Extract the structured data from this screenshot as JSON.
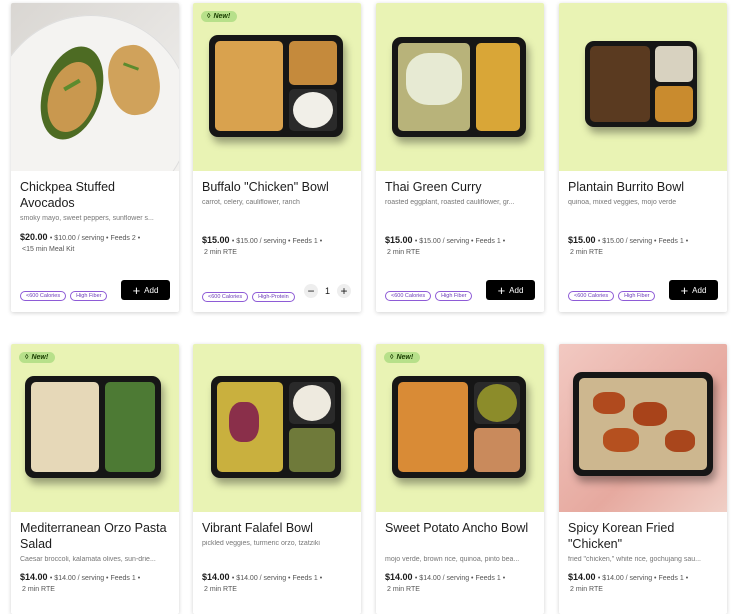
{
  "colors": {
    "card_bg": "#e9f3b4",
    "tag_border": "#8e5bd6",
    "add_button": "#000000",
    "new_badge": "#b7e08a"
  },
  "products": [
    {
      "name": "Chickpea Stuffed Avocados",
      "desc": "smoky mayo, sweet peppers, sunflower s...",
      "price": "$20.00",
      "serving": "• $10.00 / serving • Feeds 2 •",
      "time": "<15 min Meal Kit",
      "badge": "",
      "tags": [
        "<600 Calories",
        "High Fiber"
      ],
      "action": "+ Add",
      "quantity": null
    },
    {
      "name": "Buffalo \"Chicken\" Bowl",
      "desc": "carrot, celery, cauliflower, ranch",
      "price": "$15.00",
      "serving": "• $15.00 / serving • Feeds 1 •",
      "time": "2 min RTE",
      "badge": "New!",
      "tags": [
        "<600 Calories",
        "High-Protein"
      ],
      "action": "",
      "quantity": "1"
    },
    {
      "name": "Thai Green Curry",
      "desc": "roasted eggplant, roasted cauliflower, gr...",
      "price": "$15.00",
      "serving": "• $15.00 / serving • Feeds 1 •",
      "time": "2 min RTE",
      "badge": "",
      "tags": [
        "<600 Calories",
        "High Fiber"
      ],
      "action": "+ Add",
      "quantity": null
    },
    {
      "name": "Plantain Burrito Bowl",
      "desc": "quinoa, mixed veggies, mojo verde",
      "price": "$15.00",
      "serving": "• $15.00 / serving • Feeds 1 •",
      "time": "2 min RTE",
      "badge": "",
      "tags": [
        "<600 Calories",
        "High Fiber"
      ],
      "action": "+ Add",
      "quantity": null
    },
    {
      "name": "Mediterranean Orzo Pasta Salad",
      "desc": "Caesar broccoli, kalamata olives, sun-drie...",
      "price": "$14.00",
      "serving": "• $14.00 / serving • Feeds 1 •",
      "time": "2 min RTE",
      "badge": "New!",
      "tags": [],
      "action": "",
      "quantity": null
    },
    {
      "name": "Vibrant Falafel Bowl",
      "desc": "pickled veggies, turmeric orzo, tzatziki",
      "price": "$14.00",
      "serving": "• $14.00 / serving • Feeds 1 •",
      "time": "2 min RTE",
      "badge": "",
      "tags": [],
      "action": "",
      "quantity": null
    },
    {
      "name": "Sweet Potato Ancho Bowl",
      "desc": "mojo verde, brown rice, quinoa, pinto bea...",
      "price": "$14.00",
      "serving": "• $14.00 / serving • Feeds 1 •",
      "time": "2 min RTE",
      "badge": "New!",
      "tags": [],
      "action": "",
      "quantity": null
    },
    {
      "name": "Spicy Korean Fried \"Chicken\"",
      "desc": "fried \"chicken,\" white rice, gochujang sau...",
      "price": "$14.00",
      "serving": "• $14.00 / serving • Feeds 1 •",
      "time": "2 min RTE",
      "badge": "",
      "tags": [],
      "action": "",
      "quantity": null
    }
  ],
  "stepper": {
    "minus": "−",
    "plus": "+"
  },
  "add_button": {
    "plus": "+",
    "label": "Add"
  },
  "badge_icon": "spark-icon"
}
